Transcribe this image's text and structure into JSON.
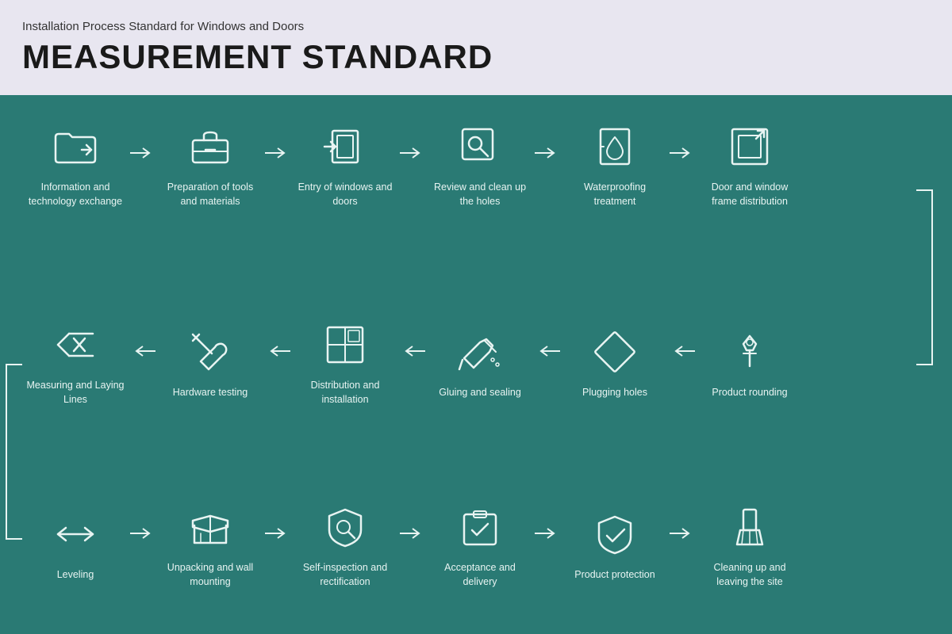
{
  "header": {
    "subtitle": "Installation Process Standard for Windows and Doors",
    "title": "MEASUREMENT STANDARD"
  },
  "steps": {
    "row1": [
      {
        "id": "info-tech",
        "label": "Information and technology exchange",
        "icon": "folder"
      },
      {
        "id": "prep-tools",
        "label": "Preparation of tools and materials",
        "icon": "toolbox"
      },
      {
        "id": "entry-windows",
        "label": "Entry of windows and doors",
        "icon": "entry"
      },
      {
        "id": "review-holes",
        "label": "Review and clean up the holes",
        "icon": "magnifier"
      },
      {
        "id": "waterproofing",
        "label": "Waterproofing treatment",
        "icon": "waterproof"
      },
      {
        "id": "frame-dist",
        "label": "Door and window frame distribution",
        "icon": "frame"
      }
    ],
    "row2": [
      {
        "id": "measuring",
        "label": "Measuring and Laying Lines",
        "icon": "measure"
      },
      {
        "id": "hardware",
        "label": "Hardware testing",
        "icon": "wrench"
      },
      {
        "id": "dist-install",
        "label": "Distribution and installation",
        "icon": "grid"
      },
      {
        "id": "gluing",
        "label": "Gluing and sealing",
        "icon": "glue"
      },
      {
        "id": "plugging",
        "label": "Plugging holes",
        "icon": "plug"
      },
      {
        "id": "product-round",
        "label": "Product rounding",
        "icon": "pin"
      }
    ],
    "row3": [
      {
        "id": "leveling",
        "label": "Leveling",
        "icon": "level"
      },
      {
        "id": "unpacking",
        "label": "Unpacking and wall mounting",
        "icon": "unpack"
      },
      {
        "id": "self-inspect",
        "label": "Self-inspection and rectification",
        "icon": "inspect"
      },
      {
        "id": "acceptance",
        "label": "Acceptance and delivery",
        "icon": "accept"
      },
      {
        "id": "product-protect",
        "label": "Product protection",
        "icon": "protect"
      },
      {
        "id": "cleanup",
        "label": "Cleaning up and leaving the site",
        "icon": "broom"
      }
    ]
  },
  "colors": {
    "background": "#2a7a74",
    "header_bg": "#e8e6f0",
    "icon_stroke": "#e8f4f2",
    "arrow": "#e8f4f2"
  }
}
